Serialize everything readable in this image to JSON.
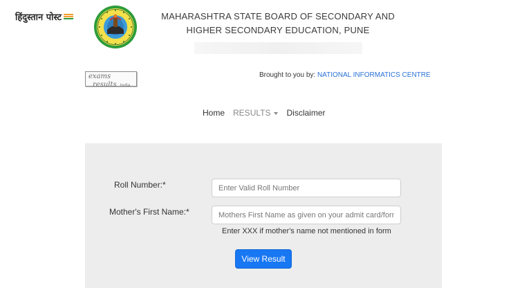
{
  "header": {
    "partner_logo_text": "हिंदुस्तान पोस्ट",
    "board_title_line1": "MAHARASHTRA STATE BOARD OF SECONDARY AND",
    "board_title_line2": "HIGHER SECONDARY EDUCATION, PUNE"
  },
  "sponsor": {
    "logo_word1": "exams",
    "logo_word2": "results",
    "logo_word3": "India",
    "brought_text": "Brought to you by:",
    "brought_link": "NATIONAL INFORMATICS CENTRE"
  },
  "nav": {
    "home": "Home",
    "results": "RESULTS",
    "disclaimer": "Disclaimer"
  },
  "form": {
    "roll_label": "Roll Number:*",
    "roll_placeholder": "Enter Valid Roll Number",
    "mother_label": "Mother's First Name:*",
    "mother_placeholder": "Mothers First Name as given on your admit card/form",
    "mother_hint": "Enter XXX if mother's name not mentioned in form",
    "submit_label": "View Result"
  },
  "colors": {
    "link": "#2b72d6",
    "button": "#1877f2",
    "panel": "#ededed",
    "flag_saffron": "#f39c2a",
    "flag_green": "#2e9b3c"
  }
}
